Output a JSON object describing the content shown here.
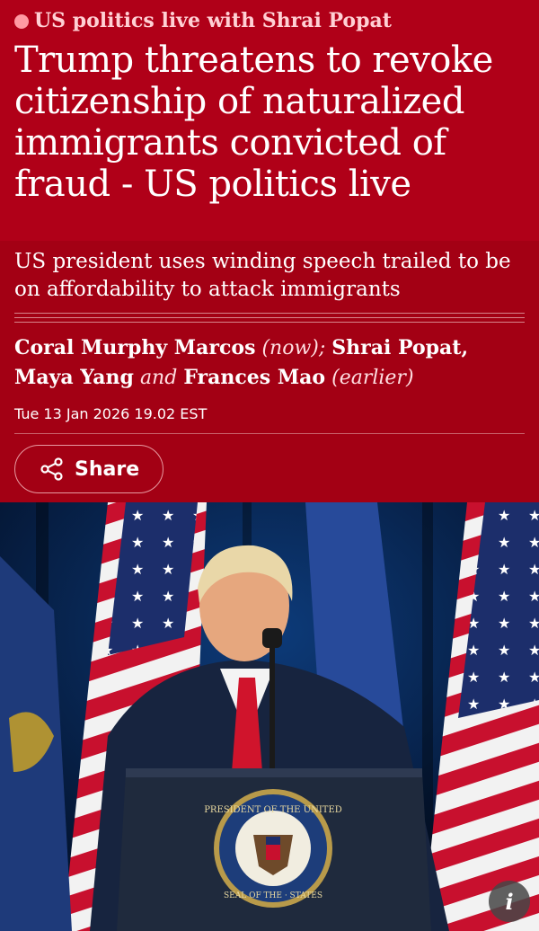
{
  "kicker": "US politics live with Shrai Popat",
  "headline": "Trump threatens to revoke citizenship of naturalized immigrants convicted of fraud - US politics live",
  "standfirst": "US president uses winding speech trailed to be on affordability to attack immigrants",
  "byline": {
    "author1": "Coral Murphy Marcos",
    "note1": "(now);",
    "author2": "Shrai Popat,",
    "author3": "Maya Yang",
    "conj": "and",
    "author4": "Frances Mao",
    "note2": "(earlier)"
  },
  "date": "Tue 13 Jan 2026 19.02 EST",
  "share_label": "Share",
  "photo": {
    "seal_text_top": "PRESIDENT OF THE UNITED",
    "seal_text_bottom": "SEAL OF THE · STATES"
  },
  "info_label": "i",
  "colors": {
    "header": "#b00018",
    "sub": "#a30014",
    "kicker": "#ffd0d4"
  }
}
